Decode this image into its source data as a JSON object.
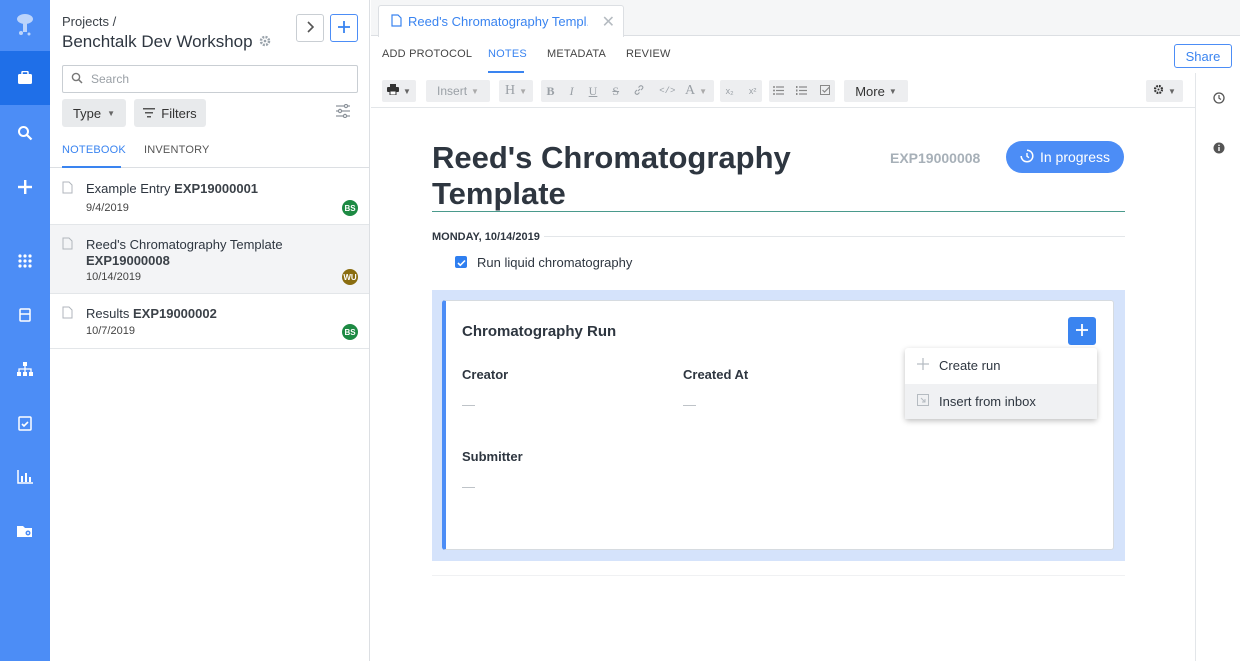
{
  "rail": {
    "icons": [
      "logo-icon",
      "briefcase-icon",
      "search-icon",
      "plus-icon",
      "apps-icon",
      "layout-icon",
      "hierarchy-icon",
      "clipboard-check-icon",
      "bar-chart-icon",
      "folder-settings-icon"
    ],
    "active": "briefcase-icon",
    "color": "#4c8df6",
    "active_color": "#1f6fe8"
  },
  "panel": {
    "breadcrumb": "Projects /",
    "project_title": "Benchtalk Dev Workshop",
    "search_placeholder": "Search",
    "type_label": "Type",
    "filters_label": "Filters",
    "tabs": [
      {
        "label": "NOTEBOOK",
        "active": true
      },
      {
        "label": "INVENTORY",
        "active": false
      }
    ],
    "entries": [
      {
        "title": "Example Entry",
        "id": "EXP19000001",
        "date": "9/4/2019",
        "avatar": "BS",
        "avatar_color": "#1d8a43",
        "selected": false
      },
      {
        "title": "Reed's Chromatography Template",
        "id": "EXP19000008",
        "date": "10/14/2019",
        "avatar": "WU",
        "avatar_color": "#8a6d10",
        "selected": true
      },
      {
        "title": "Results",
        "id": "EXP19000002",
        "date": "10/7/2019",
        "avatar": "BS",
        "avatar_color": "#1d8a43",
        "selected": false
      }
    ]
  },
  "main": {
    "tab_title": "Reed's Chromatography Templ...",
    "nav_tabs": [
      {
        "label": "ADD PROTOCOL",
        "active": false
      },
      {
        "label": "NOTES",
        "active": true
      },
      {
        "label": "METADATA",
        "active": false
      },
      {
        "label": "REVIEW",
        "active": false
      }
    ],
    "share_label": "Share",
    "toolbar": {
      "insert_label": "Insert",
      "heading_label": "H",
      "bold": "B",
      "italic": "I",
      "underline": "U",
      "strike": "S",
      "font_color": "A",
      "subscript": "x₂",
      "superscript": "x²",
      "more_label": "More"
    },
    "document": {
      "title": "Reed's Chromatography Template",
      "exp_id": "EXP19000008",
      "status": "In progress",
      "day_heading": "MONDAY, 10/14/2019",
      "task": {
        "label": "Run liquid chromatography",
        "checked": true
      },
      "card": {
        "title": "Chromatography Run",
        "fields": [
          {
            "label": "Creator",
            "value": "—"
          },
          {
            "label": "Created At",
            "value": "—"
          },
          {
            "label": "Submitter",
            "value": "—"
          }
        ],
        "menu": [
          {
            "label": "Create run",
            "icon": "plus-icon"
          },
          {
            "label": "Insert from inbox",
            "icon": "inbox-icon"
          }
        ]
      }
    }
  },
  "colors": {
    "accent": "#3a84f0",
    "status_bg": "#4c8df6",
    "card_bg": "#d5e3fb"
  }
}
